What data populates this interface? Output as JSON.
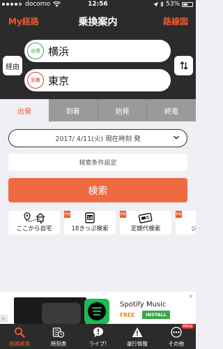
{
  "status_bar": {
    "carrier": "docomo",
    "time": "12:56",
    "battery": "53%",
    "battery_level": 0.53
  },
  "nav": {
    "left_label": "My経路",
    "title": "乗換案内",
    "right_label": "路線図"
  },
  "stations": {
    "via_label": "経由",
    "from": {
      "badge": "出発",
      "name": "横浜"
    },
    "to": {
      "badge": "到着",
      "name": "東京"
    }
  },
  "time_tabs": [
    "出発",
    "到着",
    "始発",
    "終電"
  ],
  "date_selector": {
    "text": "2017/ 4/11(火) 現在時刻 発"
  },
  "conditions_button": "検索条件設定",
  "search_button": "検索",
  "shortcuts": [
    {
      "label": "ここから自宅",
      "icon": "home-route-icon",
      "pr": false
    },
    {
      "label": "18きっぷ検索",
      "icon": "ticket-18-icon",
      "pr": true,
      "pr_label": "PR"
    },
    {
      "label": "定期代検索",
      "icon": "pass-card-icon",
      "pr": true,
      "pr_label": "PR"
    },
    {
      "label": "ジ",
      "icon": "partial-icon",
      "pr": true,
      "pr_label": "PR"
    }
  ],
  "ad": {
    "title": "Spotify Music",
    "free": "FREE",
    "install": "INSTALL",
    "choices": "▷",
    "close": "✕"
  },
  "tab_bar": [
    {
      "label": "経路検索",
      "icon": "search-icon",
      "active": true
    },
    {
      "label": "時刻表",
      "icon": "timetable-clock-icon",
      "active": false
    },
    {
      "label": "ライブ!",
      "icon": "live-bubble-icon",
      "active": false
    },
    {
      "label": "運行情報",
      "icon": "warning-icon",
      "active": false
    },
    {
      "label": "その他",
      "icon": "more-dots-icon",
      "active": false,
      "badge": "New"
    }
  ],
  "colors": {
    "accent": "#ee5a2c",
    "dark_bg": "#2b2b2b",
    "from_green": "#3aa84a",
    "to_red": "#d63a3a",
    "search_btn": "#ee6a40"
  }
}
